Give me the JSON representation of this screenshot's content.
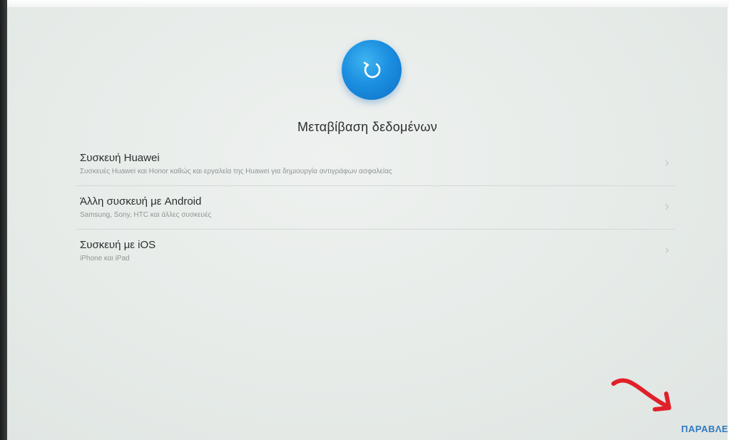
{
  "screen": {
    "title": "Μεταβίβαση δεδομένων",
    "logo_icon": "data-transfer-icon"
  },
  "options": [
    {
      "title": "Συσκευή Huawei",
      "subtitle": "Συσκευές Huawei και Honor καθώς και εργαλεία της Huawei για δημιουργία αντιγράφων ασφαλείας",
      "icon": "chevron-right-icon"
    },
    {
      "title": "Άλλη συσκευή με Android",
      "subtitle": "Samsung, Sony, HTC και άλλες συσκευές",
      "icon": "chevron-right-icon"
    },
    {
      "title": "Συσκευή με iOS",
      "subtitle": "iPhone και iPad",
      "icon": "chevron-right-icon"
    }
  ],
  "footer": {
    "skip_label": "ΠΑΡΑΒΛΕ"
  },
  "colors": {
    "accent": "#2f78c4",
    "logo_blue": "#1b8fe0",
    "annotation_red": "#e0202a"
  }
}
